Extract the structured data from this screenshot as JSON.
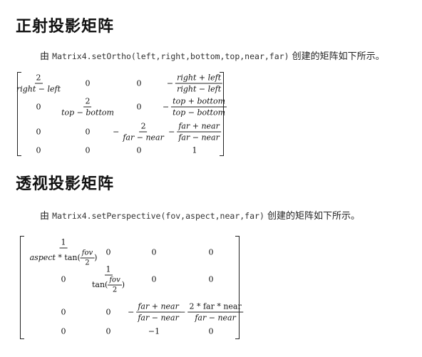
{
  "sections": [
    {
      "title": "正射投影矩阵",
      "paragraph": {
        "prefix": "由",
        "code": "Matrix4.setOrtho(left,right,bottom,top,near,far)",
        "suffix": "创建的矩阵如下所示。"
      },
      "matrix": [
        [
          {
            "t": "frac",
            "num": "2",
            "den": "right − left"
          },
          {
            "t": "text",
            "v": "0"
          },
          {
            "t": "text",
            "v": "0"
          },
          {
            "t": "frac",
            "sign": "−",
            "num": "right + left",
            "den": "right − left"
          }
        ],
        [
          {
            "t": "text",
            "v": "0"
          },
          {
            "t": "frac",
            "num": "2",
            "den": "top − bottom"
          },
          {
            "t": "text",
            "v": "0"
          },
          {
            "t": "frac",
            "sign": "−",
            "num": "top + bottom",
            "den": "top − bottom"
          }
        ],
        [
          {
            "t": "text",
            "v": "0"
          },
          {
            "t": "text",
            "v": "0"
          },
          {
            "t": "frac",
            "sign": "−",
            "num": "2",
            "den": "far − near"
          },
          {
            "t": "frac",
            "sign": "−",
            "num": "far + near",
            "den": "far − near"
          }
        ],
        [
          {
            "t": "text",
            "v": "0"
          },
          {
            "t": "text",
            "v": "0"
          },
          {
            "t": "text",
            "v": "0"
          },
          {
            "t": "text",
            "v": "1"
          }
        ]
      ]
    },
    {
      "title": "透视投影矩阵",
      "paragraph": {
        "prefix": "由",
        "code": "Matrix4.setPerspective(fov,aspect,near,far)",
        "suffix": "创建的矩阵如下所示。"
      },
      "matrix": [
        [
          {
            "t": "frac",
            "num": "1",
            "den_pre": "aspect",
            "den_mid": " * tan(",
            "den_frac_num": "fov",
            "den_frac_den": "2",
            "den_post": ")"
          },
          {
            "t": "text",
            "v": "0"
          },
          {
            "t": "text",
            "v": "0"
          },
          {
            "t": "text",
            "v": "0"
          }
        ],
        [
          {
            "t": "text",
            "v": "0"
          },
          {
            "t": "frac",
            "num": "1",
            "den_pre": "",
            "den_mid": "tan(",
            "den_frac_num": "fov",
            "den_frac_den": "2",
            "den_post": ")"
          },
          {
            "t": "text",
            "v": "0"
          },
          {
            "t": "text",
            "v": "0"
          }
        ],
        [
          {
            "t": "text",
            "v": "0"
          },
          {
            "t": "text",
            "v": "0"
          },
          {
            "t": "frac",
            "sign": "−",
            "num": "far + near",
            "den": "far − near"
          },
          {
            "t": "frac",
            "sign": "−",
            "num": "2 * far * near",
            "den": "far − near"
          }
        ],
        [
          {
            "t": "text",
            "v": "0"
          },
          {
            "t": "text",
            "v": "0"
          },
          {
            "t": "text",
            "v": "−1"
          },
          {
            "t": "text",
            "v": "0"
          }
        ]
      ]
    }
  ]
}
